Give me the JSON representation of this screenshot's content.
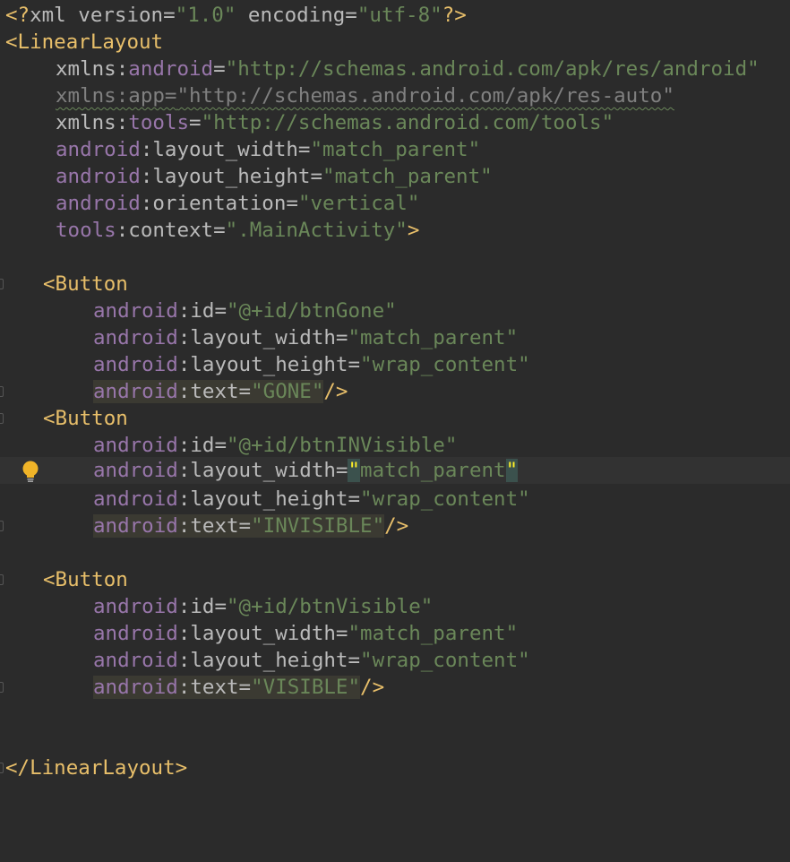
{
  "lines": {
    "l1": {
      "a": "<?",
      "b": "xml version=",
      "c": "\"1.0\"",
      "d": " encoding=",
      "e": "\"utf-8\"",
      "f": "?>"
    },
    "l2": {
      "a": "<",
      "b": "LinearLayout"
    },
    "l3": {
      "a": "xmlns:",
      "b": "android",
      "c": "=",
      "d": "\"http://schemas.android.com/apk/res/android\""
    },
    "l4": {
      "a": "xmlns:app=",
      "b": "\"http://schemas.android.com/apk/res-auto\""
    },
    "l5": {
      "a": "xmlns:",
      "b": "tools",
      "c": "=",
      "d": "\"http://schemas.android.com/tools\""
    },
    "l6": {
      "a": "android",
      "b": ":layout_width=",
      "c": "\"match_parent\""
    },
    "l7": {
      "a": "android",
      "b": ":layout_height=",
      "c": "\"match_parent\""
    },
    "l8": {
      "a": "android",
      "b": ":orientation=",
      "c": "\"vertical\""
    },
    "l9": {
      "a": "tools",
      "b": ":context=",
      "c": "\".MainActivity\"",
      "d": ">"
    },
    "l11": {
      "a": "<",
      "b": "Button"
    },
    "l12": {
      "a": "android",
      "b": ":id=",
      "c": "\"@+id/btnGone\""
    },
    "l13": {
      "a": "android",
      "b": ":layout_width=",
      "c": "\"match_parent\""
    },
    "l14": {
      "a": "android",
      "b": ":layout_height=",
      "c": "\"wrap_content\""
    },
    "l15": {
      "a": "android",
      "b": ":text=",
      "c": "\"GONE\"",
      "d": "/>"
    },
    "l16": {
      "a": "<",
      "b": "Button"
    },
    "l17": {
      "a": "android",
      "b": ":id=",
      "c": "\"@+id/btnINVisible\""
    },
    "l18": {
      "a": "android",
      "b": ":layout_width=",
      "c": "\"",
      "d": "match_parent",
      "e": "\""
    },
    "l19": {
      "a": "android",
      "b": ":layout_height=",
      "c": "\"wrap_content\""
    },
    "l20": {
      "a": "android",
      "b": ":text=",
      "c": "\"INVISIBLE\"",
      "d": "/>"
    },
    "l22": {
      "a": "<",
      "b": "Button"
    },
    "l23": {
      "a": "android",
      "b": ":id=",
      "c": "\"@+id/btnVisible\""
    },
    "l24": {
      "a": "android",
      "b": ":layout_width=",
      "c": "\"match_parent\""
    },
    "l25": {
      "a": "android",
      "b": ":layout_height=",
      "c": "\"wrap_content\""
    },
    "l26": {
      "a": "android",
      "b": ":text=",
      "c": "\"VISIBLE\"",
      "d": "/>"
    },
    "l29": {
      "a": "</",
      "b": "LinearLayout",
      "c": ">"
    }
  },
  "icons": {
    "intention": "lightbulb-icon",
    "fold": "fold-marker-icon"
  },
  "colors": {
    "background": "#2b2b2b",
    "tag": "#e8bf6a",
    "namespace": "#9876aa",
    "string": "#6a8759",
    "text": "#bababa",
    "current_line": "#323232"
  }
}
